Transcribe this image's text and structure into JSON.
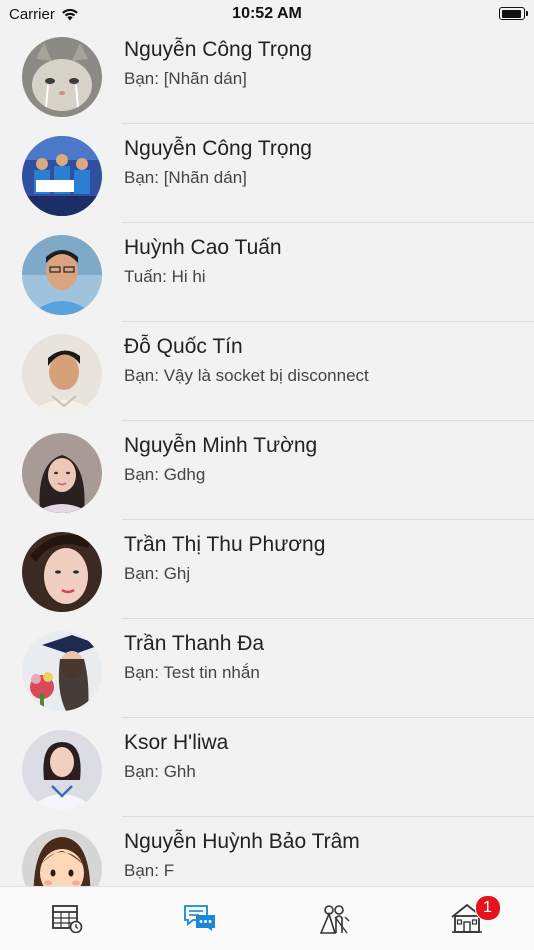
{
  "status_bar": {
    "carrier": "Carrier",
    "time": "10:52 AM",
    "battery_level": 0.95
  },
  "conversations": [
    {
      "name": "Nguyễn Công Trọng",
      "last_message": "Bạn: [Nhãn dán]",
      "avatar": "cat-photo"
    },
    {
      "name": "Nguyễn Công Trọng",
      "last_message": "Bạn: [Nhãn dán]",
      "avatar": "group-award-photo"
    },
    {
      "name": "Huỳnh Cao Tuấn",
      "last_message": "Tuấn: Hi hi",
      "avatar": "man-portrait-photo"
    },
    {
      "name": "Đỗ Quốc Tín",
      "last_message": "Bạn: Vậy là socket bị disconnect",
      "avatar": "young-man-photo"
    },
    {
      "name": "Nguyễn Minh Tường",
      "last_message": "Bạn: Gdhg",
      "avatar": "woman-portrait-photo"
    },
    {
      "name": "Trần Thị Thu Phương",
      "last_message": "Bạn: Ghj",
      "avatar": "woman-closeup-photo"
    },
    {
      "name": "Trần Thanh Đa",
      "last_message": "Bạn: Test tin nhắn",
      "avatar": "graduation-photo"
    },
    {
      "name": "Ksor H'liwa",
      "last_message": "Bạn: Ghh",
      "avatar": "woman-uniform-photo"
    },
    {
      "name": "Nguyễn Huỳnh Bảo Trâm",
      "last_message": "Bạn: F",
      "avatar": "cartoon-girl-avatar"
    }
  ],
  "tab_bar": {
    "tabs": [
      {
        "icon": "calendar-clock-icon",
        "active": false
      },
      {
        "icon": "chat-bubbles-icon",
        "active": true
      },
      {
        "icon": "wedding-couple-icon",
        "active": false
      },
      {
        "icon": "house-icon",
        "active": false,
        "badge": "1"
      }
    ],
    "active_color": "#1a88d6",
    "inactive_color": "#333333",
    "badge_color": "#e4141e"
  }
}
